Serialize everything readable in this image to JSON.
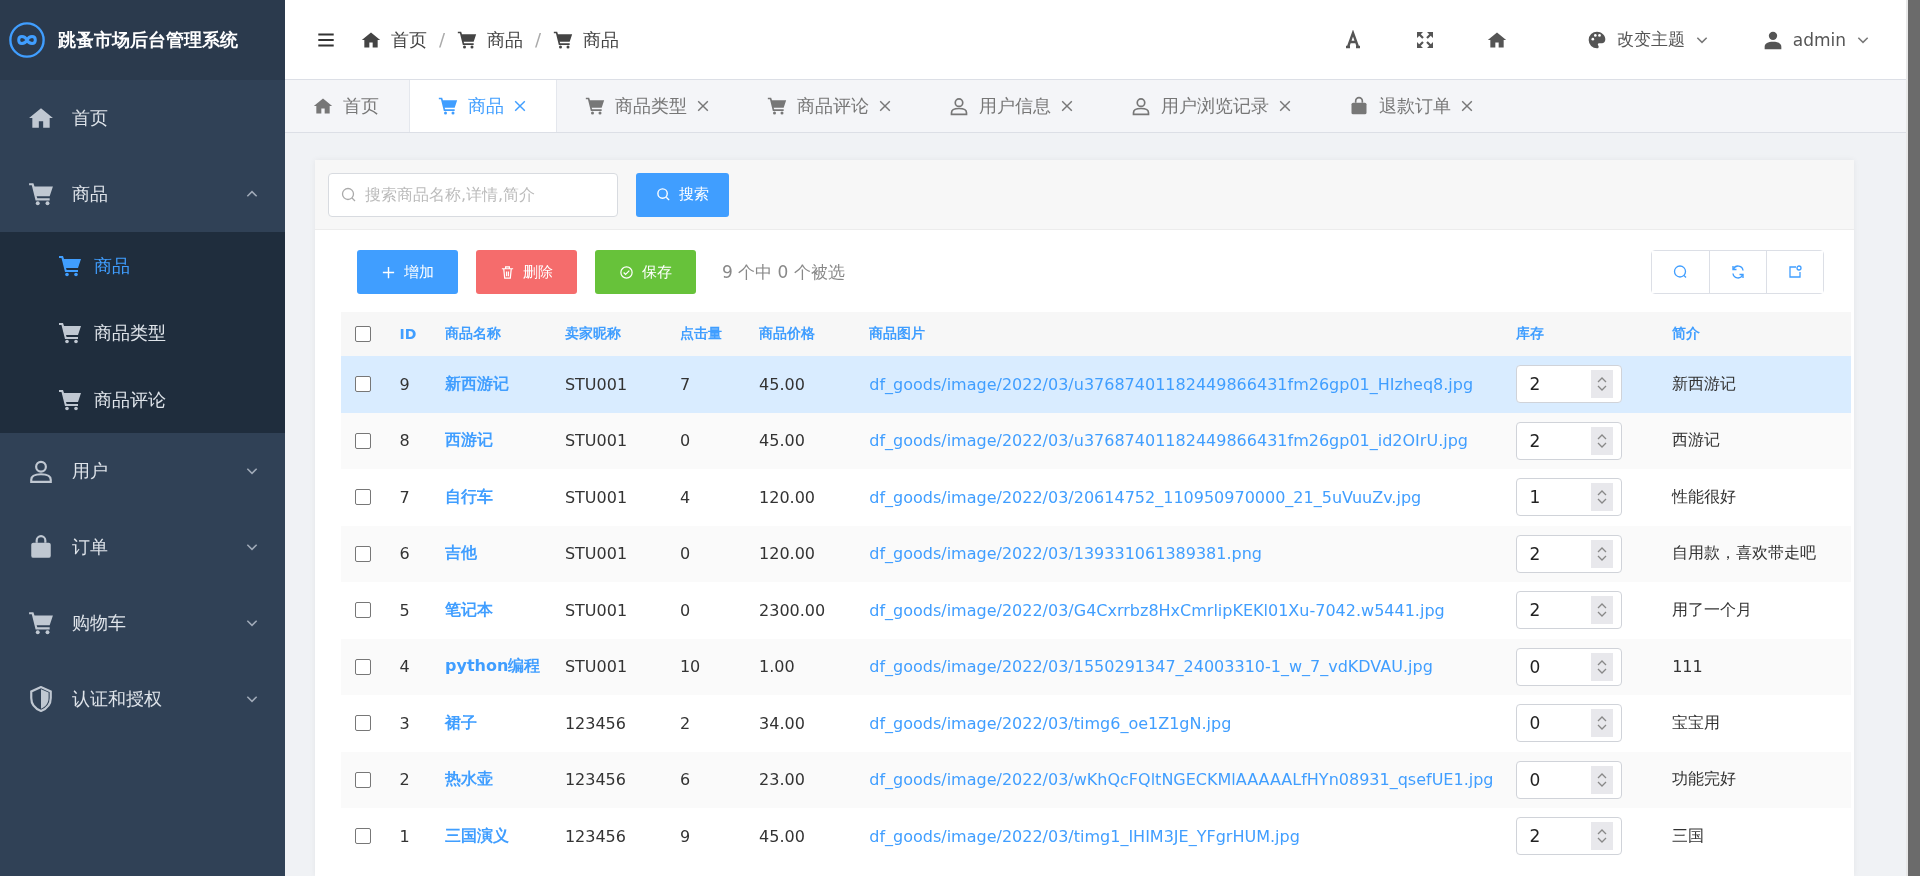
{
  "app": {
    "title": "跳蚤市场后台管理系统"
  },
  "sidebar": {
    "items": [
      {
        "label": "首页",
        "kind": "home",
        "selected": false
      },
      {
        "label": "商品",
        "kind": "cart",
        "expanded": true,
        "children": [
          {
            "label": "商品",
            "kind": "cart",
            "selected": true
          },
          {
            "label": "商品类型",
            "kind": "cart",
            "selected": false
          },
          {
            "label": "商品评论",
            "kind": "cart",
            "selected": false
          }
        ]
      },
      {
        "label": "用户",
        "kind": "user",
        "expanded": false
      },
      {
        "label": "订单",
        "kind": "bag",
        "expanded": false
      },
      {
        "label": "购物车",
        "kind": "cart",
        "expanded": false
      },
      {
        "label": "认证和授权",
        "kind": "shield",
        "expanded": false
      }
    ]
  },
  "breadcrumb": [
    {
      "label": "首页",
      "kind": "home"
    },
    {
      "separator": "/",
      "label": "商品",
      "kind": "cart"
    },
    {
      "separator": "/",
      "label": "商品",
      "kind": "cart"
    }
  ],
  "header_right": {
    "theme_label": "改变主题",
    "user": "admin"
  },
  "tabs": [
    {
      "label": "首页",
      "kind": "home",
      "closable": false,
      "selected": false
    },
    {
      "label": "商品",
      "kind": "cart",
      "closable": true,
      "selected": true
    },
    {
      "label": "商品类型",
      "kind": "cart",
      "closable": true,
      "selected": false
    },
    {
      "label": "商品评论",
      "kind": "cart",
      "closable": true,
      "selected": false
    },
    {
      "label": "用户信息",
      "kind": "user",
      "closable": true,
      "selected": false
    },
    {
      "label": "用户浏览记录",
      "kind": "user",
      "closable": true,
      "selected": false
    },
    {
      "label": "退款订单",
      "kind": "bag",
      "closable": true,
      "selected": false
    }
  ],
  "search": {
    "placeholder": "搜索商品名称,详情,简介",
    "button": "搜索"
  },
  "toolbar": {
    "buttons": [
      {
        "label": "增加",
        "kind": "add"
      },
      {
        "label": "删除",
        "kind": "delete"
      },
      {
        "label": "保存",
        "kind": "save"
      }
    ],
    "selection_info": "9 个中 0 个被选"
  },
  "table": {
    "columns": [
      "ID",
      "商品名称",
      "卖家昵称",
      "点击量",
      "商品价格",
      "商品图片",
      "库存",
      "简介"
    ],
    "header_checked": false,
    "rows": [
      {
        "cells": [
          "9",
          "新西游记",
          "STU001",
          "7",
          "45.00",
          "df_goods/image/2022/03/u37687401182449866431fm26gp01_HIzheq8.jpg",
          "2",
          "新西游记"
        ],
        "checked": false,
        "selected": true
      },
      {
        "cells": [
          "8",
          "西游记",
          "STU001",
          "0",
          "45.00",
          "df_goods/image/2022/03/u37687401182449866431fm26gp01_id2OIrU.jpg",
          "2",
          "西游记"
        ],
        "checked": false,
        "selected": false
      },
      {
        "cells": [
          "7",
          "自行车",
          "STU001",
          "4",
          "120.00",
          "df_goods/image/2022/03/20614752_110950970000_21_5uVuuZv.jpg",
          "1",
          "性能很好"
        ],
        "checked": false,
        "selected": false
      },
      {
        "cells": [
          "6",
          "吉他",
          "STU001",
          "0",
          "120.00",
          "df_goods/image/2022/03/139331061389381.png",
          "2",
          "自用款，喜欢带走吧"
        ],
        "checked": false,
        "selected": false
      },
      {
        "cells": [
          "5",
          "笔记本",
          "STU001",
          "0",
          "2300.00",
          "df_goods/image/2022/03/G4Cxrrbz8HxCmrlipKEKl01Xu-7042.w5441.jpg",
          "2",
          "用了一个月"
        ],
        "checked": false,
        "selected": false
      },
      {
        "cells": [
          "4",
          "python编程",
          "STU001",
          "10",
          "1.00",
          "df_goods/image/2022/03/1550291347_24003310-1_w_7_vdKDVAU.jpg",
          "0",
          "111"
        ],
        "checked": false,
        "selected": false
      },
      {
        "cells": [
          "3",
          "裙子",
          "123456",
          "2",
          "34.00",
          "df_goods/image/2022/03/timg6_oe1Z1gN.jpg",
          "0",
          "宝宝用"
        ],
        "checked": false,
        "selected": false
      },
      {
        "cells": [
          "2",
          "热水壶",
          "123456",
          "6",
          "23.00",
          "df_goods/image/2022/03/wKhQcFQltNGECKMlAAAAALfHYn08931_qsefUE1.jpg",
          "0",
          "功能完好"
        ],
        "checked": false,
        "selected": false
      },
      {
        "cells": [
          "1",
          "三国演义",
          "123456",
          "9",
          "45.00",
          "df_goods/image/2022/03/timg1_IHIM3JE_YFgrHUM.jpg",
          "2",
          "三国"
        ],
        "checked": false,
        "selected": false
      }
    ]
  }
}
